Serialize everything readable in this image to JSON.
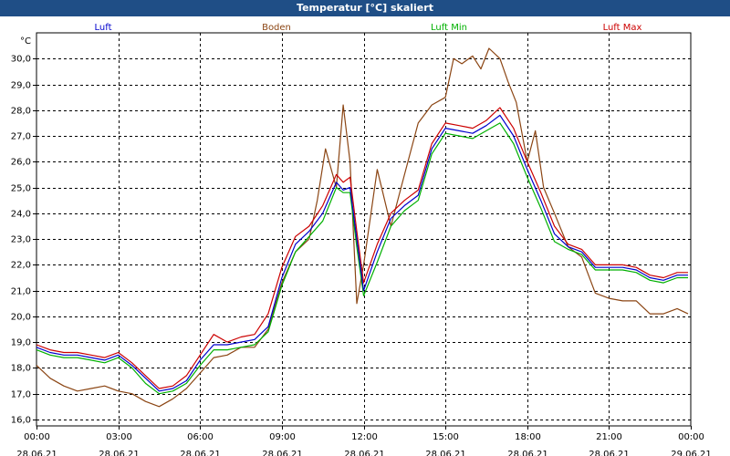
{
  "title": "Temperatur [°C] skaliert",
  "chart_data": {
    "type": "line",
    "title": "Temperatur [°C] skaliert",
    "y_unit": "°C",
    "ylim": [
      15.75,
      31.0
    ],
    "y_ticks": [
      "16,0",
      "17,0",
      "18,0",
      "19,0",
      "20,0",
      "21,0",
      "22,0",
      "23,0",
      "24,0",
      "25,0",
      "26,0",
      "27,0",
      "28,0",
      "29,0",
      "30,0"
    ],
    "y_tick_values": [
      16,
      17,
      18,
      19,
      20,
      21,
      22,
      23,
      24,
      25,
      26,
      27,
      28,
      29,
      30
    ],
    "xlim": [
      0,
      24
    ],
    "x_ticks": [
      {
        "h": 0,
        "time": "00:00",
        "date": "28.06.21"
      },
      {
        "h": 3,
        "time": "03:00",
        "date": "28.06.21"
      },
      {
        "h": 6,
        "time": "06:00",
        "date": "28.06.21"
      },
      {
        "h": 9,
        "time": "09:00",
        "date": "28.06.21"
      },
      {
        "h": 12,
        "time": "12:00",
        "date": "28.06.21"
      },
      {
        "h": 15,
        "time": "15:00",
        "date": "28.06.21"
      },
      {
        "h": 18,
        "time": "18:00",
        "date": "28.06.21"
      },
      {
        "h": 21,
        "time": "21:00",
        "date": "28.06.21"
      },
      {
        "h": 24,
        "time": "00:00",
        "date": "29.06.21"
      }
    ],
    "grid": true,
    "series": [
      {
        "name": "Luft",
        "color": "#0000cc",
        "x": [
          0,
          0.5,
          1,
          1.5,
          2,
          2.5,
          3,
          3.5,
          4,
          4.5,
          5,
          5.5,
          6,
          6.5,
          7,
          7.5,
          8,
          8.5,
          9,
          9.5,
          10,
          10.5,
          11,
          11.25,
          11.5,
          11.75,
          12,
          12.5,
          13,
          13.5,
          14,
          14.5,
          15,
          15.5,
          16,
          16.5,
          17,
          17.5,
          18,
          18.5,
          19,
          19.5,
          20,
          20.5,
          21,
          21.5,
          22,
          22.5,
          23,
          23.5,
          23.9
        ],
        "y": [
          18.8,
          18.6,
          18.5,
          18.5,
          18.4,
          18.3,
          18.5,
          18.1,
          17.6,
          17.1,
          17.2,
          17.5,
          18.3,
          18.9,
          18.9,
          19.0,
          19.1,
          19.6,
          21.5,
          22.8,
          23.3,
          24.0,
          25.2,
          24.9,
          25.0,
          23.0,
          21.0,
          22.5,
          23.8,
          24.3,
          24.7,
          26.5,
          27.3,
          27.2,
          27.1,
          27.4,
          27.8,
          27.0,
          25.7,
          24.5,
          23.2,
          22.7,
          22.5,
          21.9,
          21.9,
          21.9,
          21.8,
          21.5,
          21.4,
          21.6,
          21.6
        ]
      },
      {
        "name": "Boden",
        "color": "#8b4513",
        "x": [
          0,
          0.5,
          1,
          1.5,
          2,
          2.5,
          3,
          3.5,
          4,
          4.5,
          5,
          5.5,
          6,
          6.5,
          7,
          7.5,
          8,
          8.5,
          9,
          9.5,
          10,
          10.3,
          10.6,
          11,
          11.25,
          11.5,
          11.75,
          12,
          12.5,
          13,
          13.5,
          14,
          14.5,
          15,
          15.3,
          15.6,
          16,
          16.3,
          16.6,
          17,
          17.3,
          17.6,
          18,
          18.3,
          18.6,
          19,
          19.5,
          20,
          20.5,
          21,
          21.5,
          22,
          22.5,
          23,
          23.5,
          23.9
        ],
        "y": [
          18.1,
          17.6,
          17.3,
          17.1,
          17.2,
          17.3,
          17.1,
          17.0,
          16.7,
          16.5,
          16.8,
          17.2,
          17.8,
          18.4,
          18.5,
          18.8,
          18.8,
          19.5,
          21.3,
          22.5,
          23.0,
          24.5,
          26.5,
          25.0,
          28.2,
          26.0,
          20.5,
          22.0,
          25.7,
          23.5,
          25.5,
          27.5,
          28.2,
          28.5,
          30.0,
          29.8,
          30.1,
          29.6,
          30.4,
          30.0,
          29.1,
          28.3,
          26.0,
          27.2,
          25.0,
          24.0,
          22.7,
          22.3,
          20.9,
          20.7,
          20.6,
          20.6,
          20.1,
          20.1,
          20.3,
          20.1
        ]
      },
      {
        "name": "Luft Min",
        "color": "#00b000",
        "x": [
          0,
          0.5,
          1,
          1.5,
          2,
          2.5,
          3,
          3.5,
          4,
          4.5,
          5,
          5.5,
          6,
          6.5,
          7,
          7.5,
          8,
          8.5,
          9,
          9.5,
          10,
          10.5,
          11,
          11.25,
          11.5,
          11.75,
          12,
          12.5,
          13,
          13.5,
          14,
          14.5,
          15,
          15.5,
          16,
          16.5,
          17,
          17.5,
          18,
          18.5,
          19,
          19.5,
          20,
          20.5,
          21,
          21.5,
          22,
          22.5,
          23,
          23.5,
          23.9
        ],
        "y": [
          18.7,
          18.5,
          18.4,
          18.4,
          18.3,
          18.2,
          18.4,
          18.0,
          17.4,
          17.0,
          17.1,
          17.4,
          18.1,
          18.7,
          18.7,
          18.8,
          18.9,
          19.4,
          21.2,
          22.5,
          23.1,
          23.7,
          25.0,
          24.8,
          24.8,
          22.7,
          20.8,
          22.1,
          23.5,
          24.1,
          24.5,
          26.3,
          27.1,
          27.0,
          26.9,
          27.2,
          27.5,
          26.7,
          25.4,
          24.2,
          22.9,
          22.6,
          22.4,
          21.8,
          21.8,
          21.8,
          21.7,
          21.4,
          21.3,
          21.5,
          21.5
        ]
      },
      {
        "name": "Luft Max",
        "color": "#cc0000",
        "x": [
          0,
          0.5,
          1,
          1.5,
          2,
          2.5,
          3,
          3.5,
          4,
          4.5,
          5,
          5.5,
          6,
          6.5,
          7,
          7.5,
          8,
          8.5,
          9,
          9.5,
          10,
          10.5,
          11,
          11.25,
          11.5,
          11.75,
          12,
          12.5,
          13,
          13.5,
          14,
          14.5,
          15,
          15.5,
          16,
          16.5,
          17,
          17.5,
          18,
          18.5,
          19,
          19.5,
          20,
          20.5,
          21,
          21.5,
          22,
          22.5,
          23,
          23.5,
          23.9
        ],
        "y": [
          18.9,
          18.7,
          18.6,
          18.6,
          18.5,
          18.4,
          18.6,
          18.2,
          17.7,
          17.2,
          17.3,
          17.7,
          18.5,
          19.3,
          19.0,
          19.2,
          19.3,
          20.1,
          21.9,
          23.1,
          23.5,
          24.3,
          25.5,
          25.2,
          25.4,
          23.3,
          21.3,
          22.8,
          24.0,
          24.5,
          24.9,
          26.7,
          27.5,
          27.4,
          27.3,
          27.6,
          28.1,
          27.3,
          26.0,
          24.8,
          23.5,
          22.8,
          22.6,
          22.0,
          22.0,
          22.0,
          21.9,
          21.6,
          21.5,
          21.7,
          21.7
        ]
      }
    ]
  }
}
